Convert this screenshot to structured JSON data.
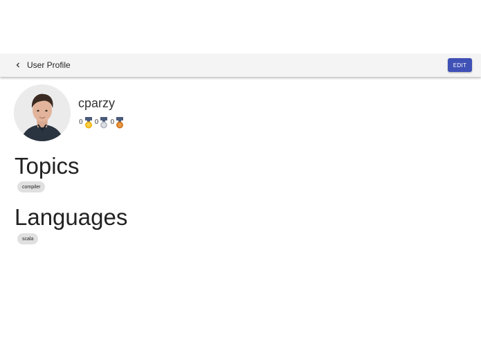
{
  "header": {
    "title": "User Profile",
    "edit_label": "EDIT",
    "accent_color": "#3f51b5"
  },
  "profile": {
    "username": "cparzy",
    "badges": [
      {
        "count": "0",
        "medal": "gold"
      },
      {
        "count": "0",
        "medal": "silver"
      },
      {
        "count": "0",
        "medal": "bronze"
      }
    ]
  },
  "sections": {
    "topics": {
      "title": "Topics",
      "chips": [
        "compiler"
      ]
    },
    "languages": {
      "title": "Languages",
      "chips": [
        "scala"
      ]
    }
  }
}
